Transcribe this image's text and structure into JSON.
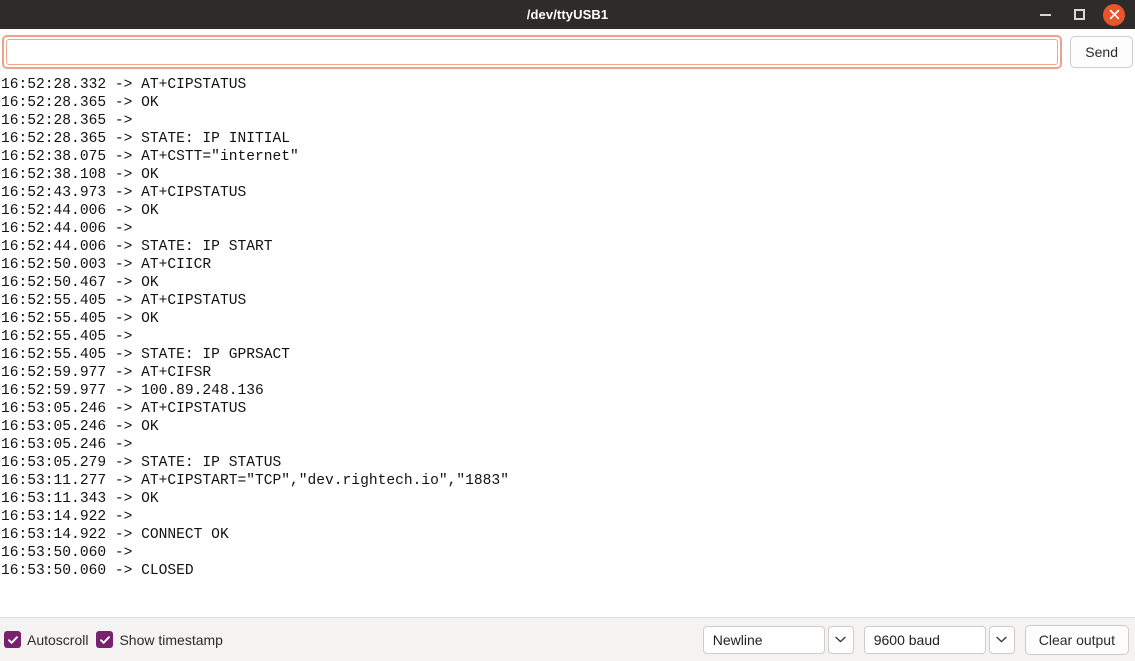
{
  "window": {
    "title": "/dev/ttyUSB1",
    "controls": {
      "minimize": "minimize",
      "maximize": "maximize",
      "close": "close"
    }
  },
  "send_row": {
    "input_value": "",
    "input_placeholder": "",
    "send_label": "Send"
  },
  "log": {
    "lines": [
      "16:52:28.332 -> AT+CIPSTATUS",
      "16:52:28.365 -> OK",
      "16:52:28.365 -> ",
      "16:52:28.365 -> STATE: IP INITIAL",
      "16:52:38.075 -> AT+CSTT=\"internet\"",
      "16:52:38.108 -> OK",
      "16:52:43.973 -> AT+CIPSTATUS",
      "16:52:44.006 -> OK",
      "16:52:44.006 -> ",
      "16:52:44.006 -> STATE: IP START",
      "16:52:50.003 -> AT+CIICR",
      "16:52:50.467 -> OK",
      "16:52:55.405 -> AT+CIPSTATUS",
      "16:52:55.405 -> OK",
      "16:52:55.405 -> ",
      "16:52:55.405 -> STATE: IP GPRSACT",
      "16:52:59.977 -> AT+CIFSR",
      "16:52:59.977 -> 100.89.248.136",
      "16:53:05.246 -> AT+CIPSTATUS",
      "16:53:05.246 -> OK",
      "16:53:05.246 -> ",
      "16:53:05.279 -> STATE: IP STATUS",
      "16:53:11.277 -> AT+CIPSTART=\"TCP\",\"dev.rightech.io\",\"1883\"",
      "16:53:11.343 -> OK",
      "16:53:14.922 -> ",
      "16:53:14.922 -> CONNECT OK",
      "16:53:50.060 -> ",
      "16:53:50.060 -> CLOSED"
    ]
  },
  "statusbar": {
    "autoscroll_label": "Autoscroll",
    "autoscroll_checked": true,
    "show_timestamp_label": "Show timestamp",
    "show_timestamp_checked": true,
    "line_ending_value": "Newline",
    "baud_value": "9600 baud",
    "clear_label": "Clear output"
  },
  "colors": {
    "titlebar_bg": "#2e2c2b",
    "close_button": "#e9552a",
    "input_focus_border": "#efa189",
    "checkbox_checked": "#77216f",
    "statusbar_bg": "#f4f3f2"
  }
}
